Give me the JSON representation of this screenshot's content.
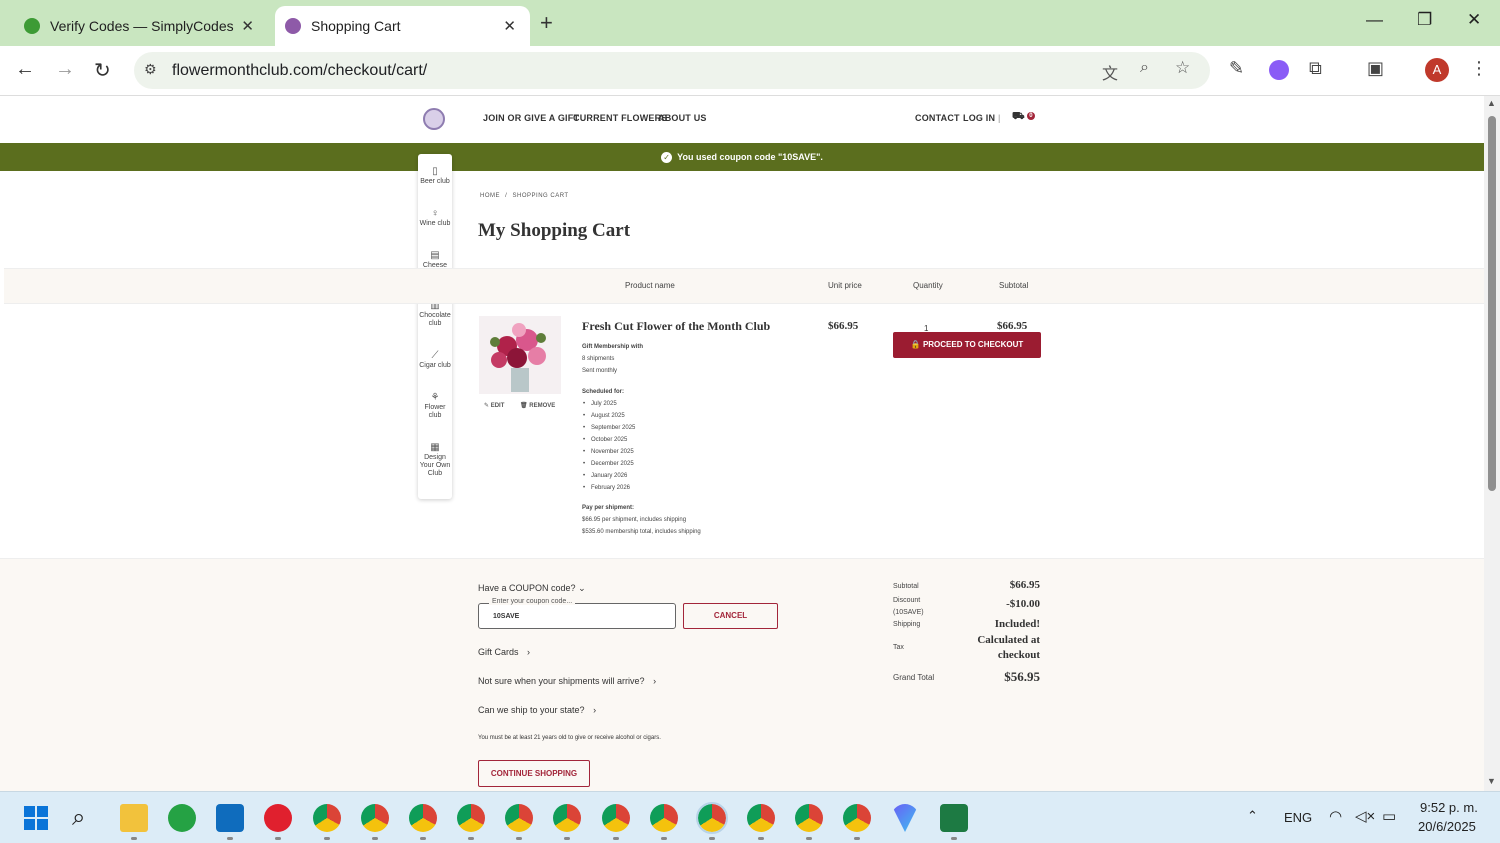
{
  "browser": {
    "tabs": [
      {
        "title": "Verify Codes — SimplyCodes",
        "active": false
      },
      {
        "title": "Shopping Cart",
        "active": true
      }
    ],
    "url": "flowermonthclub.com/checkout/cart/",
    "profile_initial": "A"
  },
  "site": {
    "nav": {
      "join": "JOIN OR GIVE A GIFT",
      "current": "CURRENT FLOWERS",
      "about": "ABOUT US",
      "contact": "CONTACT",
      "login": "LOG IN",
      "cart_count": "0"
    },
    "banner": "You used coupon code \"10SAVE\".",
    "clubs": [
      {
        "label": "Beer club",
        "icon": "beer-icon"
      },
      {
        "label": "Wine club",
        "icon": "wine-icon"
      },
      {
        "label": "Cheese club",
        "icon": "cheese-icon"
      },
      {
        "label": "Chocolate club",
        "icon": "chocolate-icon"
      },
      {
        "label": "Cigar club",
        "icon": "cigar-icon"
      },
      {
        "label": "Flower club",
        "icon": "flower-icon"
      },
      {
        "label": "Design Your Own Club",
        "icon": "design-icon"
      }
    ],
    "breadcrumb": {
      "home": "HOME",
      "sep": "/",
      "current": "SHOPPING CART"
    },
    "page_title": "My Shopping Cart",
    "table_headers": {
      "product": "Product name",
      "unit": "Unit price",
      "qty": "Quantity",
      "subtotal": "Subtotal"
    },
    "item": {
      "name": "Fresh Cut Flower of the Month Club",
      "edit": "EDIT",
      "remove": "REMOVE",
      "unit_price": "$66.95",
      "quantity": "1",
      "subtotal": "$66.95",
      "gift_heading": "Gift Membership with",
      "shipments": "8 shipments",
      "frequency": "Sent monthly",
      "scheduled_heading": "Scheduled for:",
      "schedule": [
        "July 2025",
        "August 2025",
        "September 2025",
        "October 2025",
        "November 2025",
        "December 2025",
        "January 2026",
        "February 2026"
      ],
      "pay_heading": "Pay per shipment:",
      "pay_line1": "$66.95 per shipment, includes shipping",
      "pay_line2": "$535.60 membership total, includes shipping"
    },
    "coupon": {
      "question": "Have a COUPON code?",
      "label": "Enter your coupon code...",
      "value": "10SAVE",
      "cancel": "CANCEL"
    },
    "links": {
      "gift_cards": "Gift Cards",
      "shipments_when": "Not sure when your shipments will arrive?",
      "ship_state": "Can we ship to your state?"
    },
    "age_note": "You must be at least 21 years old to give or receive alcohol or cigars.",
    "continue": "CONTINUE SHOPPING",
    "summary": {
      "subtotal_label": "Subtotal",
      "subtotal": "$66.95",
      "discount_label": "Discount (10SAVE)",
      "discount": "-$10.00",
      "shipping_label": "Shipping",
      "shipping": "Included!",
      "tax_label": "Tax",
      "tax": "Calculated at checkout",
      "total_label": "Grand Total",
      "total": "$56.95",
      "checkout": "PROCEED TO CHECKOUT"
    }
  },
  "taskbar": {
    "lang": "ENG",
    "time": "9:52 p. m.",
    "date": "20/6/2025"
  }
}
